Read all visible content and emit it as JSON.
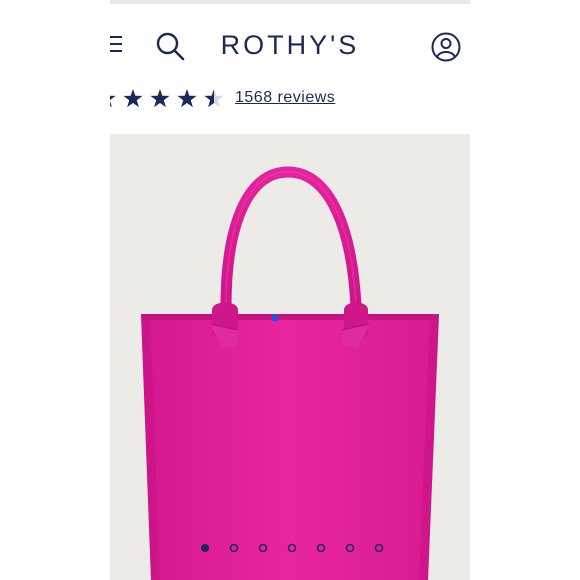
{
  "header": {
    "brand": "ROTHY'S",
    "icons": [
      "menu-icon",
      "search-icon",
      "account-icon"
    ]
  },
  "rating": {
    "stars": 4.5,
    "max_stars": 5,
    "reviews_text": "1568 reviews"
  },
  "product": {
    "image": "pink-tote-bag",
    "bag_color": "#e01f9c",
    "lining_color": "#2a4fd6"
  },
  "carousel": {
    "total": 7,
    "active_index": 0
  },
  "colors": {
    "brand_navy": "#1a2a55",
    "image_background": "#ecebe7"
  }
}
